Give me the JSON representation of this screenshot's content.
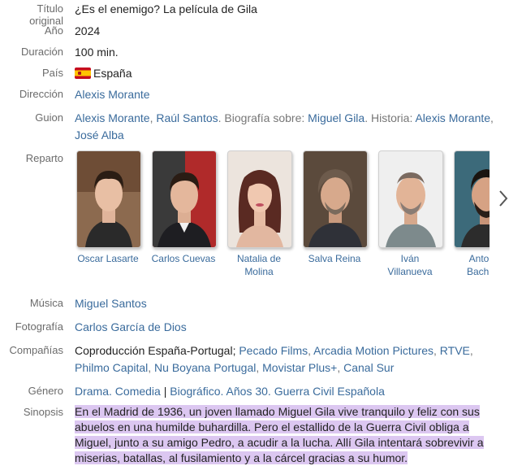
{
  "labels": {
    "titulo": "Título original",
    "anio": "Año",
    "duracion": "Duración",
    "pais": "País",
    "direccion": "Dirección",
    "guion": "Guion",
    "reparto": "Reparto",
    "musica": "Música",
    "fotografia": "Fotografía",
    "companias": "Compañías",
    "genero": "Género",
    "sinopsis": "Sinopsis"
  },
  "title": "¿Es el enemigo? La película de Gila",
  "year": "2024",
  "duration": "100 min.",
  "country": "España",
  "director": "Alexis Morante",
  "script": {
    "writer1": "Alexis Morante",
    "sep1": ", ",
    "writer2": "Raúl Santos",
    "bio_label": ". Biografía sobre: ",
    "bio_subject": "Miguel Gila",
    "story_label": ". Historia: ",
    "story1": "Alexis Morante",
    "sep2": ", ",
    "story2": "José Alba"
  },
  "cast": [
    {
      "name": "Oscar Lasarte"
    },
    {
      "name": "Carlos Cuevas"
    },
    {
      "name": "Natalia de Molina"
    },
    {
      "name": "Salva Reina"
    },
    {
      "name": "Iván Villanueva"
    },
    {
      "name": "Antonio Bachiller"
    }
  ],
  "music": "Miguel Santos",
  "photography": "Carlos García de Dios",
  "companies": {
    "prefix": "Coproducción España-Portugal; ",
    "items": [
      "Pecado Films",
      "Arcadia Motion Pictures",
      "RTVE",
      "Philmo Capital",
      "Nu Boyana Portugal",
      "Movistar Plus+",
      "Canal Sur"
    ]
  },
  "genre": {
    "g1": "Drama",
    "sep1": ". ",
    "g2": "Comedia",
    "bar": " | ",
    "g3": "Biográfico",
    "sep2": ". ",
    "g4": "Años 30",
    "sep3": ". ",
    "g5": "Guerra Civil Española"
  },
  "synopsis": "En el Madrid de 1936, un joven llamado Miguel Gila vive tranquilo y feliz con sus abuelos en una humilde buhardilla. Pero el estallido de la Guerra Civil obliga a Miguel, junto a su amigo Pedro, a acudir a la lucha. Allí Gila intentará sobrevivir a miserias, batallas, al fusilamiento y a la cárcel gracias a su humor.",
  "colors": {
    "link": "#3a6b9c",
    "label": "#6b6b6b",
    "highlight": "#dcc7f1"
  },
  "icons": {
    "country_flag": "spain-flag-icon",
    "next": "chevron-right-icon"
  }
}
